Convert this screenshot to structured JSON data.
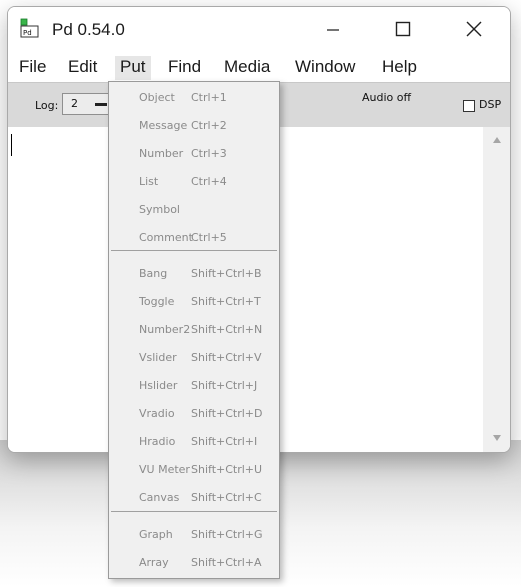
{
  "window": {
    "title": "Pd 0.54.0"
  },
  "menubar": {
    "items": [
      "File",
      "Edit",
      "Put",
      "Find",
      "Media",
      "Window",
      "Help"
    ]
  },
  "toolbar": {
    "log_label": "Log:",
    "log_value": "2",
    "audio_status": "Audio off",
    "dsp_label": "DSP",
    "dsp_checked": false
  },
  "put_menu": {
    "items": [
      {
        "label": "Object",
        "shortcut": "Ctrl+1"
      },
      {
        "label": "Message",
        "shortcut": "Ctrl+2"
      },
      {
        "label": "Number",
        "shortcut": "Ctrl+3"
      },
      {
        "label": "List",
        "shortcut": "Ctrl+4"
      },
      {
        "label": "Symbol",
        "shortcut": ""
      },
      {
        "label": "Comment",
        "shortcut": "Ctrl+5"
      },
      {
        "label": "Bang",
        "shortcut": "Shift+Ctrl+B"
      },
      {
        "label": "Toggle",
        "shortcut": "Shift+Ctrl+T"
      },
      {
        "label": "Number2",
        "shortcut": "Shift+Ctrl+N"
      },
      {
        "label": "Vslider",
        "shortcut": "Shift+Ctrl+V"
      },
      {
        "label": "Hslider",
        "shortcut": "Shift+Ctrl+J"
      },
      {
        "label": "Vradio",
        "shortcut": "Shift+Ctrl+D"
      },
      {
        "label": "Hradio",
        "shortcut": "Shift+Ctrl+I"
      },
      {
        "label": "VU Meter",
        "shortcut": "Shift+Ctrl+U"
      },
      {
        "label": "Canvas",
        "shortcut": "Shift+Ctrl+C"
      },
      {
        "label": "Graph",
        "shortcut": "Shift+Ctrl+G"
      },
      {
        "label": "Array",
        "shortcut": "Shift+Ctrl+A"
      }
    ]
  }
}
